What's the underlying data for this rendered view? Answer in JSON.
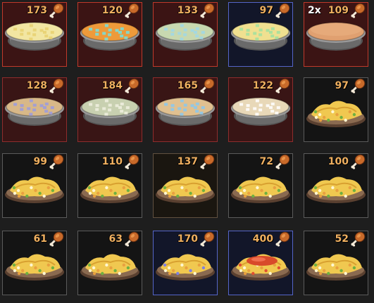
{
  "inventory": {
    "slots": [
      {
        "count": "173",
        "multiplier": "",
        "kind": "pie",
        "filling": "#f2e6a2",
        "accent": "#e8d070",
        "frame": "rare"
      },
      {
        "count": "120",
        "multiplier": "",
        "kind": "pie",
        "filling": "#ee9a3a",
        "accent": "#73e0e0",
        "frame": "rare"
      },
      {
        "count": "133",
        "multiplier": "",
        "kind": "pie",
        "filling": "#c8d8b0",
        "accent": "#9fd8e8",
        "frame": "rare"
      },
      {
        "count": "97",
        "multiplier": "",
        "kind": "pie",
        "filling": "#f0e090",
        "accent": "#a0e0a0",
        "frame": "blue"
      },
      {
        "count": "109",
        "multiplier": "2x",
        "kind": "pie-crust",
        "filling": "#e0a070",
        "accent": "#d49060",
        "frame": "rare"
      },
      {
        "count": "128",
        "multiplier": "",
        "kind": "pie",
        "filling": "#d8b888",
        "accent": "#9a9ae0",
        "frame": "rare2"
      },
      {
        "count": "184",
        "multiplier": "",
        "kind": "pie",
        "filling": "#c8d0b0",
        "accent": "#f0f0e0",
        "frame": "rare2"
      },
      {
        "count": "165",
        "multiplier": "",
        "kind": "pie",
        "filling": "#e0c090",
        "accent": "#88c8f0",
        "frame": "rare2"
      },
      {
        "count": "122",
        "multiplier": "",
        "kind": "pie",
        "filling": "#e8d8b8",
        "accent": "#ffffff",
        "frame": "rare2"
      },
      {
        "count": "97",
        "multiplier": "",
        "kind": "plate",
        "filling": "#f0c850",
        "accent": "#70b040",
        "frame": "normal"
      },
      {
        "count": "99",
        "multiplier": "",
        "kind": "plate",
        "filling": "#f0c850",
        "accent": "#70b040",
        "frame": "normal"
      },
      {
        "count": "110",
        "multiplier": "",
        "kind": "plate",
        "filling": "#f0c850",
        "accent": "#70b040",
        "frame": "normal"
      },
      {
        "count": "137",
        "multiplier": "",
        "kind": "plate",
        "filling": "#f0c850",
        "accent": "#70b040",
        "frame": "gold"
      },
      {
        "count": "72",
        "multiplier": "",
        "kind": "plate",
        "filling": "#f0c850",
        "accent": "#70b040",
        "frame": "normal"
      },
      {
        "count": "100",
        "multiplier": "",
        "kind": "plate",
        "filling": "#f0c850",
        "accent": "#70b040",
        "frame": "normal"
      },
      {
        "count": "61",
        "multiplier": "",
        "kind": "plate",
        "filling": "#f0c850",
        "accent": "#70b040",
        "frame": "normal"
      },
      {
        "count": "63",
        "multiplier": "",
        "kind": "plate",
        "filling": "#f0c850",
        "accent": "#70b040",
        "frame": "normal"
      },
      {
        "count": "170",
        "multiplier": "",
        "kind": "plate",
        "filling": "#f0c850",
        "accent": "#8080e0",
        "frame": "blue"
      },
      {
        "count": "400",
        "multiplier": "",
        "kind": "plate-meat",
        "filling": "#f0c850",
        "accent": "#e05030",
        "frame": "blue"
      },
      {
        "count": "52",
        "multiplier": "",
        "kind": "plate",
        "filling": "#f0c850",
        "accent": "#70b040",
        "frame": "normal"
      }
    ],
    "count_icon": "drumstick-icon"
  }
}
